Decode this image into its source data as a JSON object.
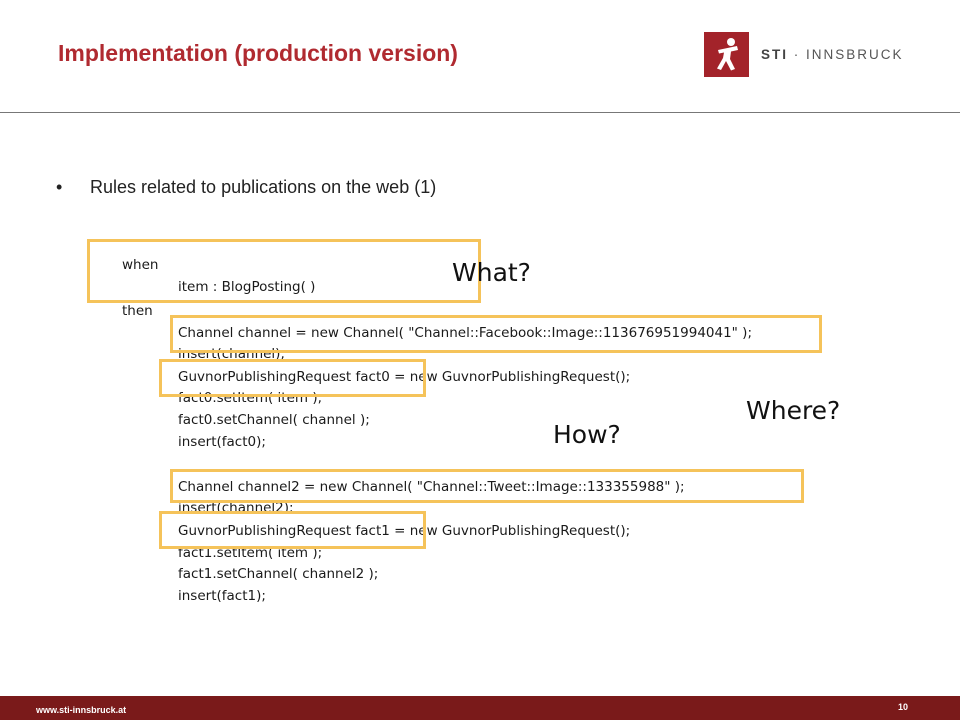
{
  "slide": {
    "title": "Implementation (production version)",
    "bullet": "Rules related to publications on the web (1)",
    "bullet_marker": "•"
  },
  "logo": {
    "brand": "STI",
    "separator": " · ",
    "name": "INNSBRUCK",
    "icon": "sti-person-icon"
  },
  "code": {
    "when": "when",
    "item": "item : BlogPosting( )",
    "then": "then",
    "l1": "Channel channel = new Channel( \"Channel::Facebook::Image::113676951994041\" );",
    "l2": "insert(channel);",
    "l3": "GuvnorPublishingRequest fact0 = new GuvnorPublishingRequest();",
    "l4": "fact0.setItem( item );",
    "l5": "fact0.setChannel( channel );",
    "l6": "insert(fact0);",
    "l7": "Channel channel2 = new Channel( \"Channel::Tweet::Image::133355988\" );",
    "l8": "insert(channel2);",
    "l9": "GuvnorPublishingRequest fact1 = new GuvnorPublishingRequest();",
    "l10": "fact1.setItem( item );",
    "l11": "fact1.setChannel( channel2 );",
    "l12": "insert(fact1);"
  },
  "callouts": {
    "what": "What?",
    "where": "Where?",
    "how": "How?"
  },
  "footer": {
    "url": "www.sti-innsbruck.at",
    "page": "10"
  },
  "colors": {
    "title": "#b02a30",
    "highlight": "#f5c35a",
    "footer": "#7a1a1a",
    "logo": "#a3232a"
  }
}
